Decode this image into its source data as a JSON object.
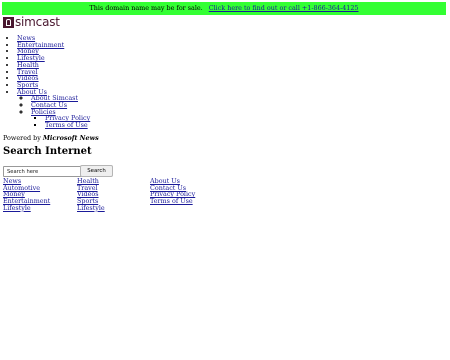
{
  "banner": {
    "text": "This domain name may be for sale.",
    "link": "Click here to find out or call +1-866-364-4125"
  },
  "logo": {
    "text": "simcast"
  },
  "nav": {
    "items": [
      "News",
      "Entertainment",
      "Money",
      "Lifestyle",
      "Health",
      "Travel",
      "Videos",
      "Sports"
    ],
    "about": {
      "label": "About Us",
      "items": [
        "About Simcast",
        "Contact Us"
      ],
      "policies": {
        "label": "Policies",
        "items": [
          "Privacy Policy",
          "Terms of Use"
        ]
      }
    }
  },
  "powered": {
    "prefix": "Powered by",
    "brand": "Microsoft News"
  },
  "search": {
    "title": "Search Internet",
    "placeholder": "Search here",
    "button": "Search"
  },
  "footer": {
    "col1": [
      "News",
      "Automotive",
      "Money",
      "Entertainment",
      "Lifestyle"
    ],
    "col2": [
      "Health",
      "Travel",
      "Videos",
      "Sports",
      "Lifestyle"
    ],
    "col3": [
      "About Us",
      "Contact Us",
      "Privacy Policy",
      "Terms of Use"
    ]
  }
}
